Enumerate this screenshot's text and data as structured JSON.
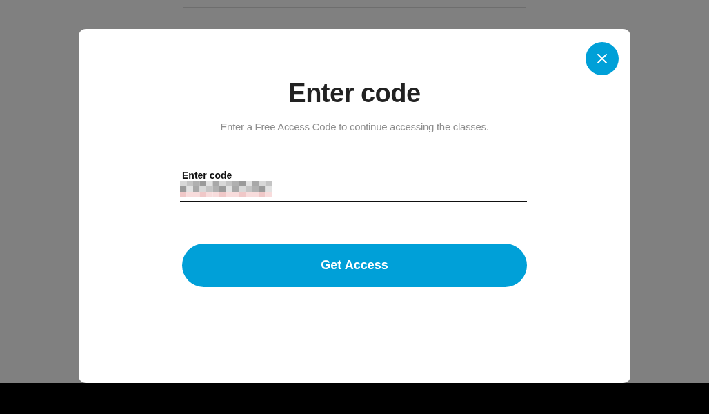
{
  "dialog": {
    "title": "Enter code",
    "subtitle": "Enter a Free Access Code to continue accessing the classes.",
    "field": {
      "label": "Enter code",
      "value_redacted": true
    },
    "button": "Get Access"
  }
}
